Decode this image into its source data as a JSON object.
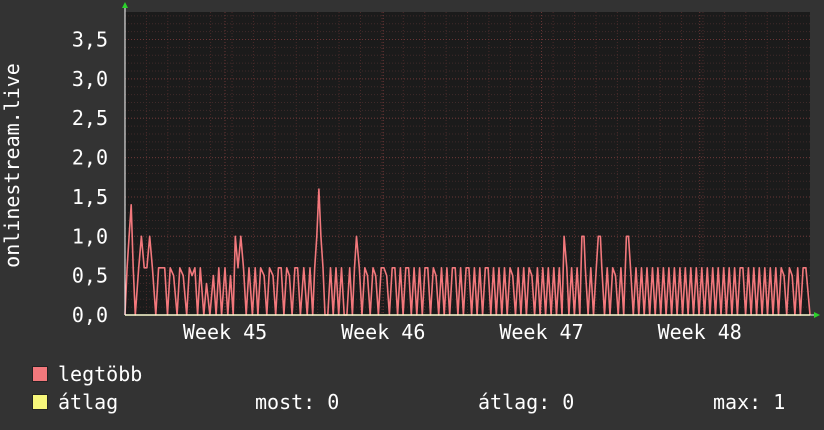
{
  "colors": {
    "background": "#333333",
    "plot_bg": "#1b1b1b",
    "max_series": "#f2787c",
    "avg_series": "#f6f67a",
    "axis_arrow": "#2bd12b"
  },
  "chart_data": {
    "type": "area",
    "title": "",
    "ylabel": "onlinestream.live",
    "ylim": [
      0,
      3.85
    ],
    "xlim": [
      0,
      100
    ],
    "yticks": [
      {
        "v": 0,
        "label": "0,0"
      },
      {
        "v": 0.5,
        "label": "0,5"
      },
      {
        "v": 1.0,
        "label": "1,0"
      },
      {
        "v": 1.5,
        "label": "1,5"
      },
      {
        "v": 2.0,
        "label": "2,0"
      },
      {
        "v": 2.5,
        "label": "2,5"
      },
      {
        "v": 3.0,
        "label": "3,0"
      },
      {
        "v": 3.5,
        "label": "3,5"
      }
    ],
    "xticks": [
      {
        "x": 14.6,
        "label": "Week 45"
      },
      {
        "x": 37.7,
        "label": "Week 46"
      },
      {
        "x": 60.8,
        "label": "Week 47"
      },
      {
        "x": 83.9,
        "label": "Week 48"
      }
    ],
    "grid": true,
    "series": [
      {
        "name": "legtöbb",
        "color": "#f2787c",
        "points": [
          [
            0,
            0
          ],
          [
            0.3,
            0.6
          ],
          [
            0.6,
            1.0
          ],
          [
            0.9,
            1.4
          ],
          [
            1.2,
            0.6
          ],
          [
            1.5,
            0
          ],
          [
            2.0,
            0.6
          ],
          [
            2.4,
            1.0
          ],
          [
            2.8,
            0.6
          ],
          [
            3.2,
            0.6
          ],
          [
            3.6,
            1.0
          ],
          [
            4.0,
            0.6
          ],
          [
            4.5,
            0
          ],
          [
            4.9,
            0.6
          ],
          [
            5.4,
            0.6
          ],
          [
            5.8,
            0.6
          ],
          [
            6.2,
            0
          ],
          [
            6.6,
            0.6
          ],
          [
            7.1,
            0.5
          ],
          [
            7.6,
            0
          ],
          [
            8.0,
            0.6
          ],
          [
            8.5,
            0.5
          ],
          [
            9.0,
            0
          ],
          [
            9.4,
            0.6
          ],
          [
            9.8,
            0.5
          ],
          [
            10.2,
            0.6
          ],
          [
            10.6,
            0
          ],
          [
            11.0,
            0.6
          ],
          [
            11.5,
            0
          ],
          [
            11.9,
            0.4
          ],
          [
            12.4,
            0
          ],
          [
            12.9,
            0.5
          ],
          [
            13.3,
            0
          ],
          [
            13.7,
            0.6
          ],
          [
            14.1,
            0
          ],
          [
            14.6,
            0.6
          ],
          [
            15.0,
            0
          ],
          [
            15.4,
            0.5
          ],
          [
            15.8,
            0
          ],
          [
            16.1,
            1.0
          ],
          [
            16.5,
            0.6
          ],
          [
            16.9,
            1.0
          ],
          [
            17.3,
            0.6
          ],
          [
            17.7,
            0
          ],
          [
            18.1,
            0.6
          ],
          [
            18.6,
            0
          ],
          [
            19.0,
            0.6
          ],
          [
            19.4,
            0
          ],
          [
            19.8,
            0.6
          ],
          [
            20.3,
            0.5
          ],
          [
            20.7,
            0
          ],
          [
            21.1,
            0.6
          ],
          [
            21.6,
            0.5
          ],
          [
            22.0,
            0
          ],
          [
            22.4,
            0.6
          ],
          [
            22.8,
            0.6
          ],
          [
            23.2,
            0
          ],
          [
            23.6,
            0.6
          ],
          [
            24.0,
            0.5
          ],
          [
            24.4,
            0
          ],
          [
            24.8,
            0.6
          ],
          [
            25.2,
            0.6
          ],
          [
            25.6,
            0
          ],
          [
            26.1,
            0.6
          ],
          [
            26.6,
            0
          ],
          [
            27.0,
            0.6
          ],
          [
            27.4,
            0
          ],
          [
            27.7,
            0.6
          ],
          [
            28.0,
            1.0
          ],
          [
            28.3,
            1.6
          ],
          [
            28.6,
            1.0
          ],
          [
            28.9,
            0.6
          ],
          [
            29.2,
            0
          ],
          [
            29.6,
            0
          ],
          [
            30.0,
            0.6
          ],
          [
            30.4,
            0
          ],
          [
            30.8,
            0.6
          ],
          [
            31.2,
            0
          ],
          [
            31.6,
            0.6
          ],
          [
            32.0,
            0
          ],
          [
            32.4,
            0
          ],
          [
            32.8,
            0.6
          ],
          [
            33.2,
            0
          ],
          [
            33.5,
            0.6
          ],
          [
            33.8,
            1.0
          ],
          [
            34.2,
            0.6
          ],
          [
            34.6,
            0
          ],
          [
            35.0,
            0.6
          ],
          [
            35.4,
            0.5
          ],
          [
            35.8,
            0
          ],
          [
            36.2,
            0.6
          ],
          [
            36.6,
            0.5
          ],
          [
            37.0,
            0
          ],
          [
            37.4,
            0.6
          ],
          [
            37.8,
            0.6
          ],
          [
            38.2,
            0.5
          ],
          [
            38.6,
            0
          ],
          [
            39.0,
            0.6
          ],
          [
            39.4,
            0.6
          ],
          [
            39.8,
            0
          ],
          [
            40.2,
            0.6
          ],
          [
            40.6,
            0
          ],
          [
            41.0,
            0.6
          ],
          [
            41.4,
            0.6
          ],
          [
            41.8,
            0
          ],
          [
            42.2,
            0.6
          ],
          [
            42.6,
            0
          ],
          [
            43.0,
            0.6
          ],
          [
            43.4,
            0
          ],
          [
            43.8,
            0.6
          ],
          [
            44.2,
            0.6
          ],
          [
            44.6,
            0
          ],
          [
            45.0,
            0.6
          ],
          [
            45.4,
            0.5
          ],
          [
            45.8,
            0
          ],
          [
            46.2,
            0.6
          ],
          [
            46.6,
            0
          ],
          [
            47.0,
            0.6
          ],
          [
            47.4,
            0
          ],
          [
            47.8,
            0.6
          ],
          [
            48.2,
            0.6
          ],
          [
            48.6,
            0
          ],
          [
            49.0,
            0.6
          ],
          [
            49.4,
            0
          ],
          [
            49.8,
            0.6
          ],
          [
            50.2,
            0.6
          ],
          [
            50.6,
            0
          ],
          [
            51.0,
            0.6
          ],
          [
            51.4,
            0
          ],
          [
            51.8,
            0.6
          ],
          [
            52.2,
            0
          ],
          [
            52.6,
            0.6
          ],
          [
            53.0,
            0.6
          ],
          [
            53.4,
            0
          ],
          [
            53.8,
            0.6
          ],
          [
            54.2,
            0
          ],
          [
            54.6,
            0.6
          ],
          [
            55.0,
            0
          ],
          [
            55.4,
            0.6
          ],
          [
            55.8,
            0
          ],
          [
            56.2,
            0.6
          ],
          [
            56.6,
            0.5
          ],
          [
            57.0,
            0
          ],
          [
            57.4,
            0.6
          ],
          [
            57.8,
            0
          ],
          [
            58.2,
            0.6
          ],
          [
            58.6,
            0
          ],
          [
            59.0,
            0.6
          ],
          [
            59.4,
            0.5
          ],
          [
            59.8,
            0
          ],
          [
            60.2,
            0.6
          ],
          [
            60.6,
            0
          ],
          [
            61.0,
            0.6
          ],
          [
            61.4,
            0
          ],
          [
            61.8,
            0.6
          ],
          [
            62.2,
            0
          ],
          [
            62.6,
            0.6
          ],
          [
            63.0,
            0
          ],
          [
            63.4,
            0.6
          ],
          [
            63.8,
            0
          ],
          [
            64.1,
            1.0
          ],
          [
            64.5,
            0.6
          ],
          [
            64.8,
            0
          ],
          [
            65.2,
            0.6
          ],
          [
            65.6,
            0
          ],
          [
            66.0,
            0.6
          ],
          [
            66.4,
            0
          ],
          [
            66.7,
            1.0
          ],
          [
            67.0,
            1.0
          ],
          [
            67.2,
            0.6
          ],
          [
            67.6,
            0
          ],
          [
            68.0,
            0.6
          ],
          [
            68.4,
            0
          ],
          [
            68.8,
            0.6
          ],
          [
            69.1,
            1.0
          ],
          [
            69.4,
            1.0
          ],
          [
            69.6,
            0.6
          ],
          [
            70.0,
            0
          ],
          [
            70.4,
            0.6
          ],
          [
            70.8,
            0
          ],
          [
            71.2,
            0.6
          ],
          [
            71.6,
            0.5
          ],
          [
            72.0,
            0
          ],
          [
            72.4,
            0.6
          ],
          [
            72.8,
            0
          ],
          [
            73.2,
            1.0
          ],
          [
            73.5,
            1.0
          ],
          [
            73.8,
            0.6
          ],
          [
            74.2,
            0
          ],
          [
            74.6,
            0.6
          ],
          [
            75.0,
            0
          ],
          [
            75.4,
            0.6
          ],
          [
            75.8,
            0
          ],
          [
            76.2,
            0.6
          ],
          [
            76.6,
            0
          ],
          [
            77.0,
            0.6
          ],
          [
            77.4,
            0
          ],
          [
            77.8,
            0.6
          ],
          [
            78.2,
            0
          ],
          [
            78.6,
            0.6
          ],
          [
            79.0,
            0
          ],
          [
            79.4,
            0.6
          ],
          [
            79.8,
            0
          ],
          [
            80.2,
            0.6
          ],
          [
            80.6,
            0
          ],
          [
            81.0,
            0.6
          ],
          [
            81.4,
            0
          ],
          [
            81.8,
            0.6
          ],
          [
            82.2,
            0
          ],
          [
            82.6,
            0.6
          ],
          [
            83.0,
            0
          ],
          [
            83.4,
            0.6
          ],
          [
            83.8,
            0
          ],
          [
            84.2,
            0.6
          ],
          [
            84.6,
            0
          ],
          [
            85.0,
            0.6
          ],
          [
            85.4,
            0
          ],
          [
            85.8,
            0.6
          ],
          [
            86.2,
            0
          ],
          [
            86.6,
            0.6
          ],
          [
            87.0,
            0
          ],
          [
            87.4,
            0.6
          ],
          [
            87.8,
            0
          ],
          [
            88.2,
            0.6
          ],
          [
            88.6,
            0
          ],
          [
            89.0,
            0.6
          ],
          [
            89.4,
            0
          ],
          [
            89.8,
            0.6
          ],
          [
            90.2,
            0.6
          ],
          [
            90.6,
            0
          ],
          [
            91.0,
            0.6
          ],
          [
            91.4,
            0
          ],
          [
            91.8,
            0.6
          ],
          [
            92.2,
            0
          ],
          [
            92.6,
            0.6
          ],
          [
            93.0,
            0
          ],
          [
            93.4,
            0.6
          ],
          [
            93.8,
            0
          ],
          [
            94.2,
            0.6
          ],
          [
            94.6,
            0
          ],
          [
            95.0,
            0.6
          ],
          [
            95.4,
            0
          ],
          [
            95.8,
            0.6
          ],
          [
            96.2,
            0.5
          ],
          [
            96.6,
            0
          ],
          [
            97.0,
            0.6
          ],
          [
            97.4,
            0.5
          ],
          [
            97.8,
            0
          ],
          [
            98.2,
            0.6
          ],
          [
            98.6,
            0
          ],
          [
            99.0,
            0.6
          ],
          [
            99.4,
            0.6
          ],
          [
            100,
            0
          ]
        ]
      },
      {
        "name": "átlag",
        "color": "#f6f67a",
        "points": [
          [
            0,
            0
          ],
          [
            100,
            0
          ]
        ]
      }
    ]
  },
  "legend": {
    "items": [
      {
        "label": "legtöbb",
        "color": "#f2787c"
      },
      {
        "label": "átlag",
        "color": "#f6f67a"
      }
    ],
    "stats": {
      "most": "most: 0",
      "atlag": "átlag: 0",
      "max": "max: 1"
    }
  }
}
